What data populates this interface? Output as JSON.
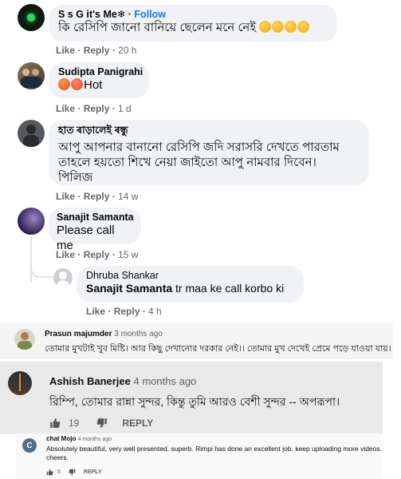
{
  "comments": [
    {
      "author": "S s G it's Me❄",
      "follow": "Follow",
      "text": "কি রেসিপি জানো বানিয়ে ছেলেন মনে নেই",
      "like": "Like",
      "reply": "Reply",
      "time": "20 h"
    },
    {
      "author": "Sudipta Panigrahi",
      "text": "Hot",
      "like": "Like",
      "reply": "Reply",
      "time": "1 d"
    },
    {
      "author": "হাত ৰাড়ালেই ৰন্ধু",
      "text_lines": [
        "আপু আপনার বানানো রেসিপি জদি সরাসরি দেখতে পারতাম",
        "তাহলে হয়তো শিখে নেয়া জাইতো আপু নামবার দিবেন।",
        "পিলিজ"
      ],
      "like": "Like",
      "reply": "Reply",
      "time": "14 w"
    },
    {
      "author": "Sanajit Samanta",
      "text": "Please call me",
      "like": "Like",
      "reply": "Reply",
      "time": "15 w"
    }
  ],
  "reply": {
    "author": "Dhruba Shankar",
    "mention": "Sanajit Samanta",
    "text": "tr maa ke call korbo ki",
    "like": "Like",
    "reply": "Reply",
    "time": "4 h"
  },
  "yt1": {
    "author": "Prasun majumder",
    "time": "3 months ago",
    "text": "তোমার মুখটাই খুব মিষ্টি। আর কিছু দেখানোর দরকার নেই।। তোমার মুখ দেখেই প্রেমে পড়ে যাওয়া যায়।"
  },
  "yt2": {
    "author": "Ashish Banerjee",
    "time": "4 months ago",
    "text": "রিম্পি, তোমার রান্না সুন্দর, কিন্তু তুমি আরও বেশী সুন্দর -- অপরূপা।",
    "likes": "19",
    "reply": "REPLY"
  },
  "yt3": {
    "avatar_letter": "C",
    "author": "chat Mojo",
    "time": "4 months ago",
    "text_lines": [
      "Absolutely beautiful, very well presented, superb. Rimpi has done an excellent job. keep uploading more videos.",
      "cheers."
    ],
    "likes": "5",
    "reply": "REPLY"
  },
  "colors": {
    "bubble": "#f0f2f5",
    "follow": "#1877f2",
    "meta": "#65676b"
  }
}
